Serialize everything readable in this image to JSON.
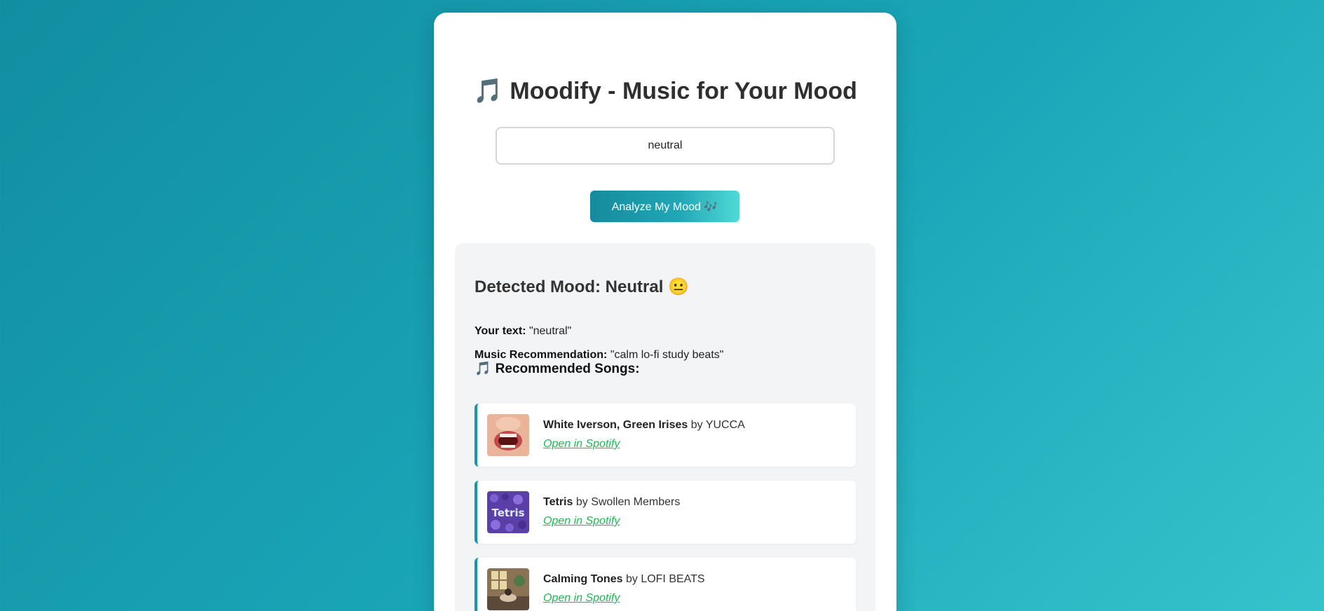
{
  "app": {
    "title_icon": "🎵",
    "title": "Moodify - Music for Your Mood"
  },
  "mood_input": {
    "value": "neutral"
  },
  "analyze_button": {
    "label": "Analyze My Mood 🎶"
  },
  "result": {
    "detected_label": "Detected Mood: Neutral",
    "detected_emoji": "😐",
    "your_text_label": "Your text:",
    "your_text_value": "\"neutral\"",
    "recommendation_label": "Music Recommendation:",
    "recommendation_value": "\"calm lo-fi study beats\"",
    "songs_heading_icon": "🎵",
    "songs_heading": "Recommended Songs:",
    "songs": [
      {
        "title": "White Iverson, Green Irises",
        "by": "by",
        "artist": "YUCCA",
        "link": "Open in Spotify",
        "cover_icon": "open-mouth-album-cover"
      },
      {
        "title": "Tetris",
        "by": "by",
        "artist": "Swollen Members",
        "link": "Open in Spotify",
        "cover_icon": "tetris-album-cover",
        "cover_text": "Tetris"
      },
      {
        "title": "Calming Tones",
        "by": "by",
        "artist": "LOFI BEATS",
        "link": "Open in Spotify",
        "cover_icon": "lofi-room-album-cover"
      }
    ]
  },
  "colors": {
    "background_start": "#128ea1",
    "background_end": "#37c3cc",
    "accent": "#1697a8",
    "link": "#1db954"
  }
}
